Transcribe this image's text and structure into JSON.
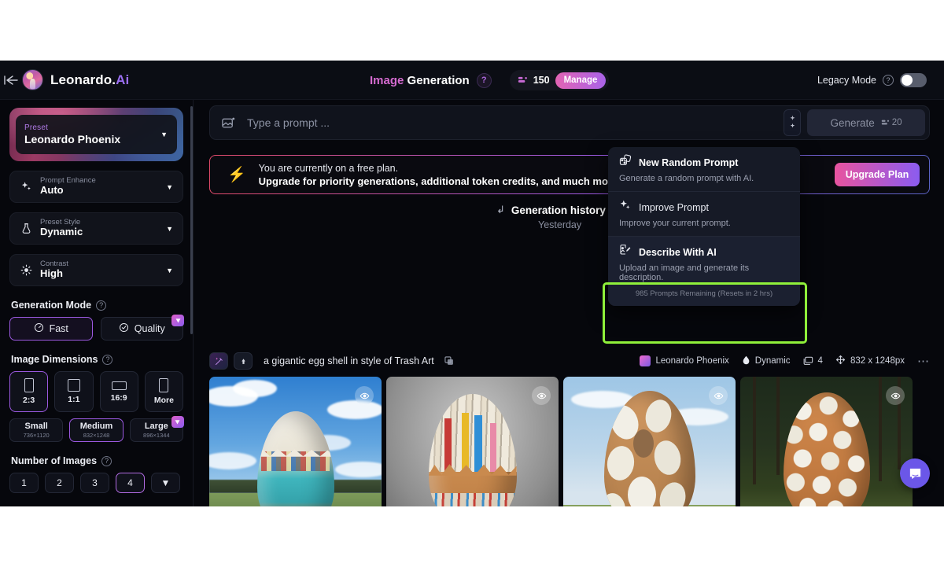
{
  "topbar": {
    "back_icon": "back-arrow-icon",
    "brand_primary": "Leonardo.",
    "brand_suffix": "Ai",
    "title_primary": "Image",
    "title_secondary": "Generation",
    "help_glyph": "?",
    "token_count": "150",
    "manage_label": "Manage",
    "legacy_label": "Legacy Mode",
    "legacy_help_glyph": "?",
    "legacy_toggle_state": "off"
  },
  "sidebar": {
    "preset": {
      "label": "Preset",
      "value": "Leonardo Phoenix"
    },
    "options": [
      {
        "label": "Prompt Enhance",
        "value": "Auto",
        "icon": "sparkle-icon"
      },
      {
        "label": "Preset Style",
        "value": "Dynamic",
        "icon": "flask-icon"
      },
      {
        "label": "Contrast",
        "value": "High",
        "icon": "sun-icon"
      }
    ],
    "generation_mode": {
      "title": "Generation Mode",
      "help_glyph": "?",
      "options": [
        {
          "label": "Fast",
          "icon": "speedometer-icon",
          "active": true,
          "premium": false
        },
        {
          "label": "Quality",
          "icon": "check-circle-icon",
          "active": false,
          "premium": true
        }
      ]
    },
    "image_dimensions": {
      "title": "Image Dimensions",
      "help_glyph": "?",
      "ratios": [
        {
          "label": "2:3",
          "active": true
        },
        {
          "label": "1:1",
          "active": false
        },
        {
          "label": "16:9",
          "active": false
        },
        {
          "label": "More",
          "active": false
        }
      ],
      "sizes": [
        {
          "name": "Small",
          "dims": "736×1120",
          "active": false,
          "premium": false
        },
        {
          "name": "Medium",
          "dims": "832×1248",
          "active": true,
          "premium": false
        },
        {
          "name": "Large",
          "dims": "896×1344",
          "active": false,
          "premium": true
        }
      ]
    },
    "number_of_images": {
      "title": "Number of Images",
      "help_glyph": "?",
      "options": [
        {
          "label": "1",
          "active": false
        },
        {
          "label": "2",
          "active": false
        },
        {
          "label": "3",
          "active": false
        },
        {
          "label": "4",
          "active": true
        },
        {
          "label": "▼",
          "active": false
        }
      ]
    }
  },
  "main": {
    "prompt": {
      "placeholder": "Type a prompt ...",
      "value": "",
      "image_icon": "image-upload-icon",
      "magic_icon": "magic-wand-icon",
      "generate_label": "Generate",
      "generate_cost": "20"
    },
    "banner": {
      "icon": "lightning-bolt-icon",
      "line1": "You are currently on a free plan.",
      "line2": "Upgrade for priority generations, additional token credits, and much more!",
      "cta_label": "Upgrade Plan"
    },
    "history": {
      "title": "Generation history",
      "day": "Yesterday"
    },
    "generation": {
      "prompt_text": "a gigantic egg shell in style of Trash Art",
      "wand_icon": "wand-sparkle-icon",
      "up_icon": "arrow-up-icon",
      "copy_icon": "copy-icon",
      "model": "Leonardo Phoenix",
      "style": "Dynamic",
      "count": "4",
      "resolution": "832 x 1248px",
      "more_icon": "ellipsis-icon",
      "thumbnails": [
        {
          "alt": "egg shell sculpture in field with blue sky",
          "eye_icon": "eye-icon"
        },
        {
          "alt": "egg shell sculpture made of magazines on grey backdrop",
          "eye_icon": "eye-icon"
        },
        {
          "alt": "open lattice egg shell sculpture outdoors",
          "eye_icon": "eye-icon"
        },
        {
          "alt": "egg shell sculpture of white plates in forest",
          "eye_icon": "eye-icon"
        }
      ]
    },
    "chat_icon": "chat-bubble-icon"
  },
  "menu": {
    "items": [
      {
        "title": "New Random Prompt",
        "subtitle": "Generate a random prompt with AI.",
        "icon": "dice-icon",
        "note": "",
        "highlighted": false
      },
      {
        "title": "Improve Prompt",
        "subtitle": "Improve your current prompt.",
        "icon": "sparkle-icon",
        "note": "",
        "highlighted": false
      },
      {
        "title": "Describe With AI",
        "subtitle": "Upload an image and generate its description.",
        "icon": "describe-image-icon",
        "note": "985 Prompts Remaining (Resets in 2 hrs)",
        "highlighted": true
      }
    ],
    "highlight_color": "#8ff03a"
  }
}
